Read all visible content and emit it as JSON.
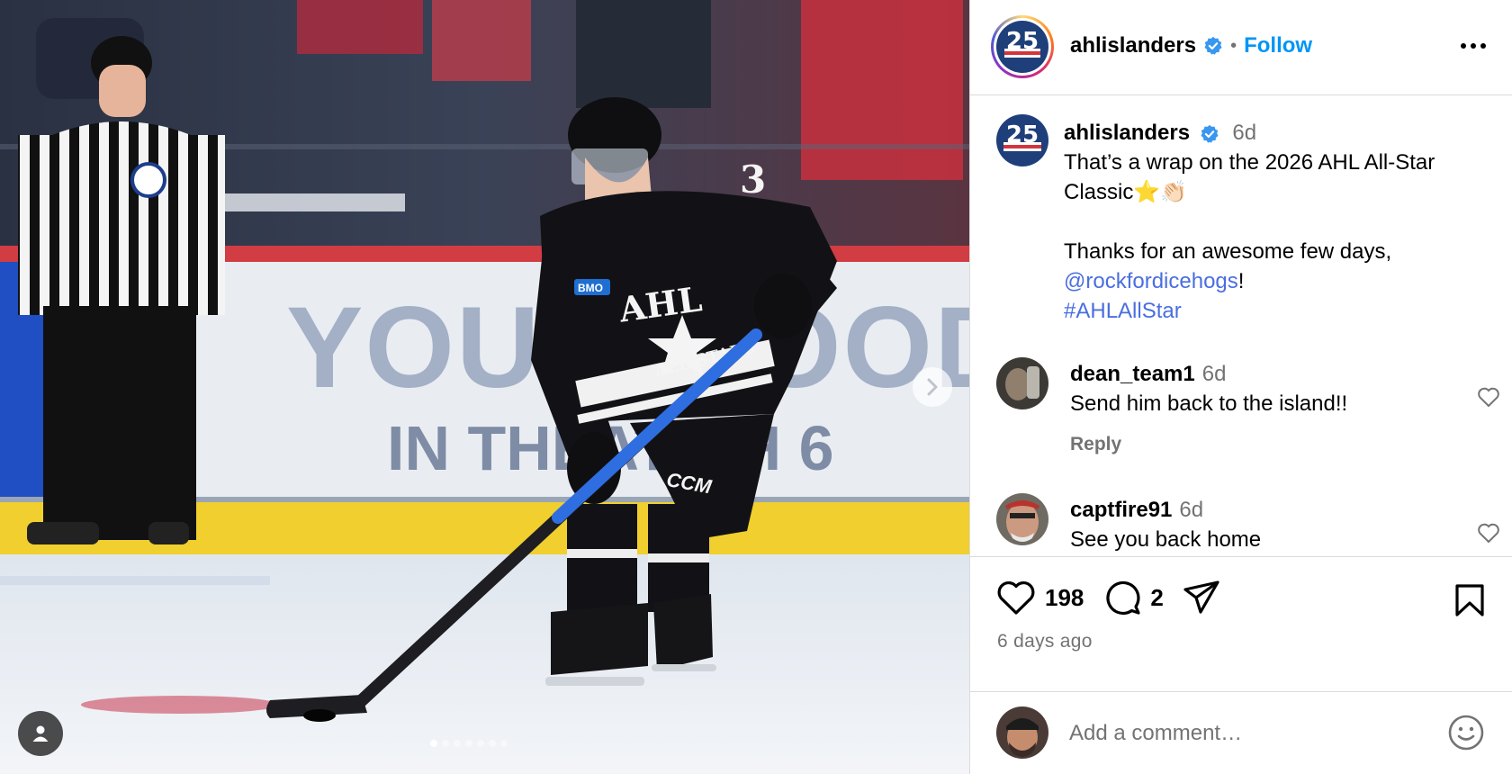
{
  "post": {
    "carousel": {
      "dot_count": 7,
      "active_index": 0
    },
    "photo_text": {
      "board_line1": "YOUNG  OOD",
      "board_line2": "IN THEAT  CH 6",
      "jersey_title": "AHL",
      "jersey_sub": "ALL-STARS",
      "jersey_number": "3",
      "ccm": "CCM",
      "sponsor": "BMO"
    }
  },
  "header": {
    "username": "ahlislanders",
    "separator": "•",
    "follow_label": "Follow",
    "avatar_label": "25"
  },
  "caption": {
    "username": "ahlislanders",
    "age": "6d",
    "line1": "That’s a wrap on the 2026 AHL All-Star Classic⭐👏🏻",
    "line2": "Thanks for an awesome few days,",
    "mention": "@rockfordicehogs",
    "mention_suffix": "!",
    "hashtag": "#AHLAllStar"
  },
  "comments": [
    {
      "username": "dean_team1",
      "age": "6d",
      "text": "Send him back to the island!!",
      "reply_label": "Reply"
    },
    {
      "username": "captfire91",
      "age": "6d",
      "text": "See you back home"
    }
  ],
  "actions": {
    "likes": "198",
    "comments": "2",
    "posted_ago": "6 days ago"
  },
  "add_comment": {
    "placeholder": "Add a comment…"
  },
  "colors": {
    "accent_blue": "#0095f6",
    "link_blue": "#4a6ee0",
    "muted": "#737373",
    "border": "#dbdbdb",
    "islanders_navy": "#1f3f7a"
  },
  "icons": [
    "verified-badge-icon",
    "more-options-icon",
    "heart-icon",
    "comment-icon",
    "share-icon",
    "bookmark-icon",
    "emoji-icon",
    "user-tag-icon",
    "chevron-right-icon"
  ]
}
